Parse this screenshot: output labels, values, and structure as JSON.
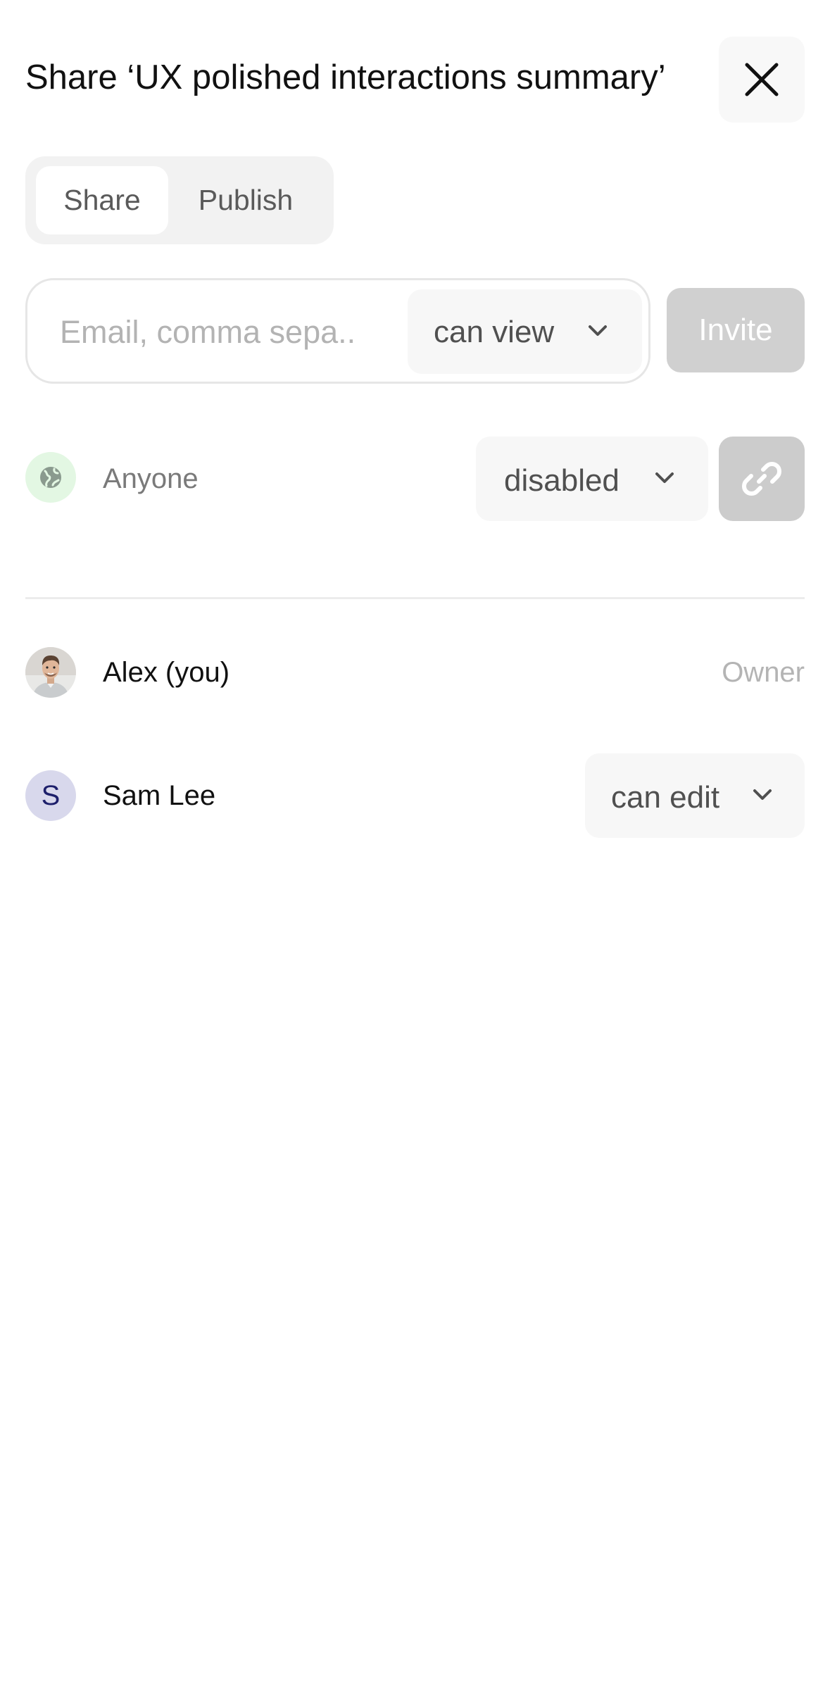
{
  "dialog": {
    "title": "Share ‘UX polished interactions summary’",
    "close_icon": "close-icon"
  },
  "tabs": [
    {
      "label": "Share",
      "selected": true
    },
    {
      "label": "Publish",
      "selected": false
    }
  ],
  "invite": {
    "email_placeholder": "Email, comma sepa...",
    "email_value": "",
    "role": "can view",
    "button_label": "Invite",
    "button_enabled": false
  },
  "general_access": {
    "icon": "globe-icon",
    "label": "Anyone",
    "role": "disabled",
    "link_icon": "link-icon"
  },
  "members": [
    {
      "name": "Alex (you)",
      "avatar": "photo",
      "role": "Owner"
    },
    {
      "name": "Sam Lee",
      "initial": "S",
      "role": "can edit"
    }
  ],
  "colors": {
    "accent_green_bg": "#e3f7e3",
    "invite_disabled_bg": "#d0d0d0",
    "avatar_initial_bg": "#d8d8ec",
    "avatar_initial_fg": "#1d1f6b"
  }
}
